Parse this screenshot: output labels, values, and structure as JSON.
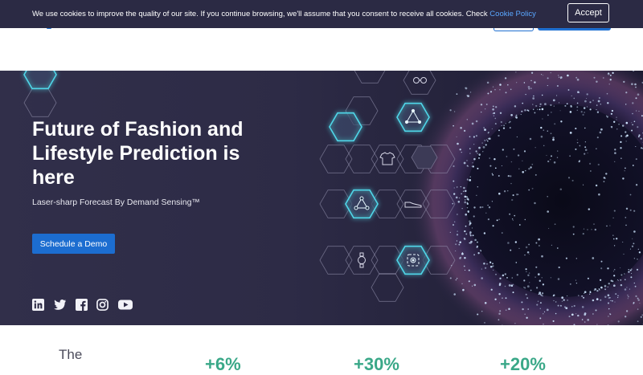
{
  "cookie_bar": {
    "message": "We use cookies to improve the quality of our site. If you continue browsing, we'll assume that you consent to receive all cookies. Check ",
    "link_label": "Cookie Policy",
    "accept_label": "Accept"
  },
  "hero": {
    "title": "Future of Fashion and Lifestyle Prediction is here",
    "subtitle": "Laser-sharp Forecast By Demand Sensing™",
    "cta_label": "Schedule a Demo"
  },
  "social": [
    "linkedin-icon",
    "twitter-icon",
    "facebook-icon",
    "instagram-icon",
    "youtube-icon"
  ],
  "stats": {
    "label": "The",
    "values": [
      "+6%",
      "+30%",
      "+20%"
    ]
  },
  "colors": {
    "cookie_bg": "#2b2a44",
    "accent_blue": "#1c6dd0",
    "cookie_link": "#5aa7ff",
    "hero_bg": "#2d2b46",
    "hex_glow": "#4fd6e8",
    "stat_green": "#3aa888"
  }
}
